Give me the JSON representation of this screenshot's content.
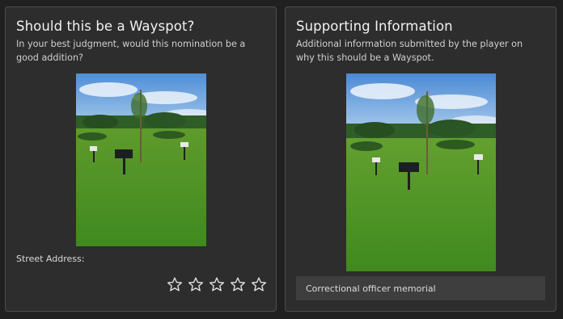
{
  "left_card": {
    "title": "Should this be a Wayspot?",
    "subtitle": "In your best judgment, would this nomination be a good addition?",
    "photo_icon": "nomination-photo",
    "address_label": "Street Address:",
    "rating": {
      "max": 5,
      "value": 0,
      "icon": "star-outline-icon"
    }
  },
  "right_card": {
    "title": "Supporting Information",
    "subtitle": "Additional information submitted by the player on why this should be a Wayspot.",
    "photo_icon": "supporting-photo",
    "info_text": "Correctional officer memorial"
  },
  "colors": {
    "background": "#202020",
    "card": "#2d2d2d",
    "card_border": "#4d4d4d",
    "info_box": "#3e3e3e",
    "star_stroke": "#e6e6e6"
  }
}
